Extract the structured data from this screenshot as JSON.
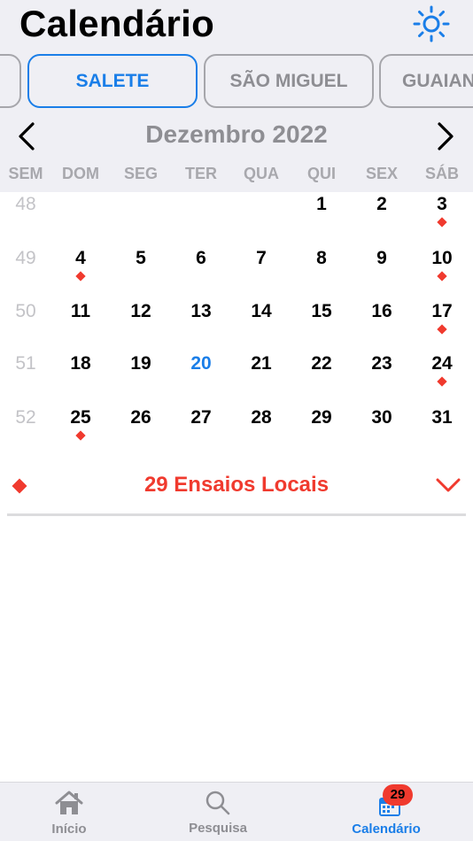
{
  "header": {
    "title": "Calendário",
    "settings_icon": "sun-icon"
  },
  "tabs": [
    {
      "label": ""
    },
    {
      "label": "SALETE",
      "active": true
    },
    {
      "label": "SÃO MIGUEL"
    },
    {
      "label": "GUAIANASES"
    }
  ],
  "calendar": {
    "month_label": "Dezembro 2022",
    "weekday_headers": [
      "SEM",
      "DOM",
      "SEG",
      "TER",
      "QUA",
      "QUI",
      "SEX",
      "SÁB"
    ],
    "weeks": [
      {
        "week": "48",
        "days": [
          "",
          "",
          "",
          "",
          "1",
          "2",
          "3"
        ]
      },
      {
        "week": "49",
        "days": [
          "4",
          "5",
          "6",
          "7",
          "8",
          "9",
          "10"
        ]
      },
      {
        "week": "50",
        "days": [
          "11",
          "12",
          "13",
          "14",
          "15",
          "16",
          "17"
        ]
      },
      {
        "week": "51",
        "days": [
          "18",
          "19",
          "20",
          "21",
          "22",
          "23",
          "24"
        ]
      },
      {
        "week": "52",
        "days": [
          "25",
          "26",
          "27",
          "28",
          "29",
          "30",
          "31"
        ]
      }
    ],
    "today": "20",
    "event_days": [
      "3",
      "4",
      "10",
      "17",
      "24",
      "25"
    ],
    "accent_color": "#1a7ee8",
    "event_color": "#f03a2e"
  },
  "summary": {
    "text": "29 Ensaios Locais"
  },
  "tabbar": {
    "items": [
      {
        "label": "Início",
        "icon": "home-icon"
      },
      {
        "label": "Pesquisa",
        "icon": "search-icon"
      },
      {
        "label": "Calendário",
        "icon": "calendar-icon",
        "active": true
      }
    ],
    "badge": "29"
  }
}
